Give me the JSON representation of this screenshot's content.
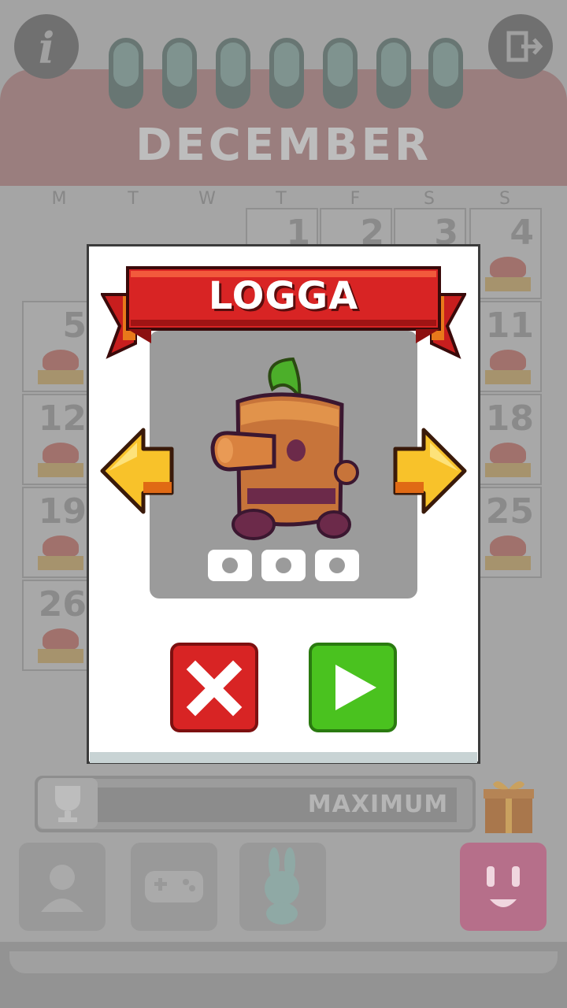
{
  "top_bar": {
    "info_icon": "info-icon",
    "exit_icon": "exit-icon"
  },
  "calendar": {
    "month": "DECEMBER",
    "weekdays": [
      "M",
      "T",
      "W",
      "T",
      "F",
      "S",
      "S"
    ],
    "visible_days": {
      "row1": [
        "1",
        "2",
        "3",
        "4"
      ],
      "left_column": [
        "5",
        "12",
        "19",
        "26"
      ],
      "right_column": [
        "11",
        "18",
        "25"
      ]
    }
  },
  "progress": {
    "label": "MAXIMUM",
    "trophy_icon": "trophy-icon",
    "gift_icon": "gift-icon"
  },
  "bottom_nav": {
    "items": [
      "profile-icon",
      "gamepad-icon",
      "bunny-icon",
      "happy-face-icon"
    ]
  },
  "dialog": {
    "character_name": "LOGGA",
    "prev_icon": "arrow-left-icon",
    "next_icon": "arrow-right-icon",
    "film_dots": 3,
    "cancel_icon": "close-icon",
    "play_icon": "play-icon",
    "colors": {
      "banner_red": "#d82424",
      "cancel_red": "#d82424",
      "play_green": "#4ac21f",
      "arrow_yellow": "#f8c22a"
    }
  }
}
